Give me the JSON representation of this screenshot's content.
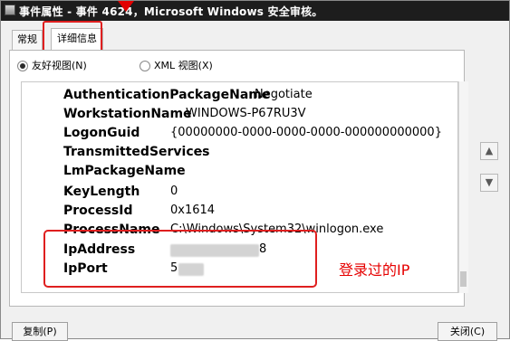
{
  "window": {
    "title": "事件属性 - 事件 4624，Microsoft Windows 安全审核。"
  },
  "tabs": [
    {
      "label": "常规"
    },
    {
      "label": "详细信息"
    }
  ],
  "view_options": {
    "friendly": "友好视图(N)",
    "xml": "XML 视图(X)",
    "selected": "friendly"
  },
  "details": [
    {
      "key": "AuthenticationPackageName",
      "value": "Negotiate"
    },
    {
      "key": "WorkstationName",
      "value": "WINDOWS-P67RU3V"
    },
    {
      "key": "LogonGuid",
      "value": "{00000000-0000-0000-0000-000000000000}"
    },
    {
      "key": "TransmittedServices",
      "value": "-"
    },
    {
      "key": "LmPackageName",
      "value": "-"
    },
    {
      "key": "KeyLength",
      "value": "0"
    },
    {
      "key": "ProcessId",
      "value": "0x1614"
    },
    {
      "key": "ProcessName",
      "value": "C:\\Windows\\System32\\winlogon.exe"
    },
    {
      "key": "IpAddress",
      "value": "8"
    },
    {
      "key": "IpPort",
      "value": "5"
    }
  ],
  "annotation": {
    "text": "登录过的IP",
    "color": "#e60000"
  },
  "buttons": {
    "copy": "复制(P)",
    "close": "关闭(C)"
  },
  "colors": {
    "titlebar": "#1d1d1d",
    "highlight": "#df1f1f"
  }
}
